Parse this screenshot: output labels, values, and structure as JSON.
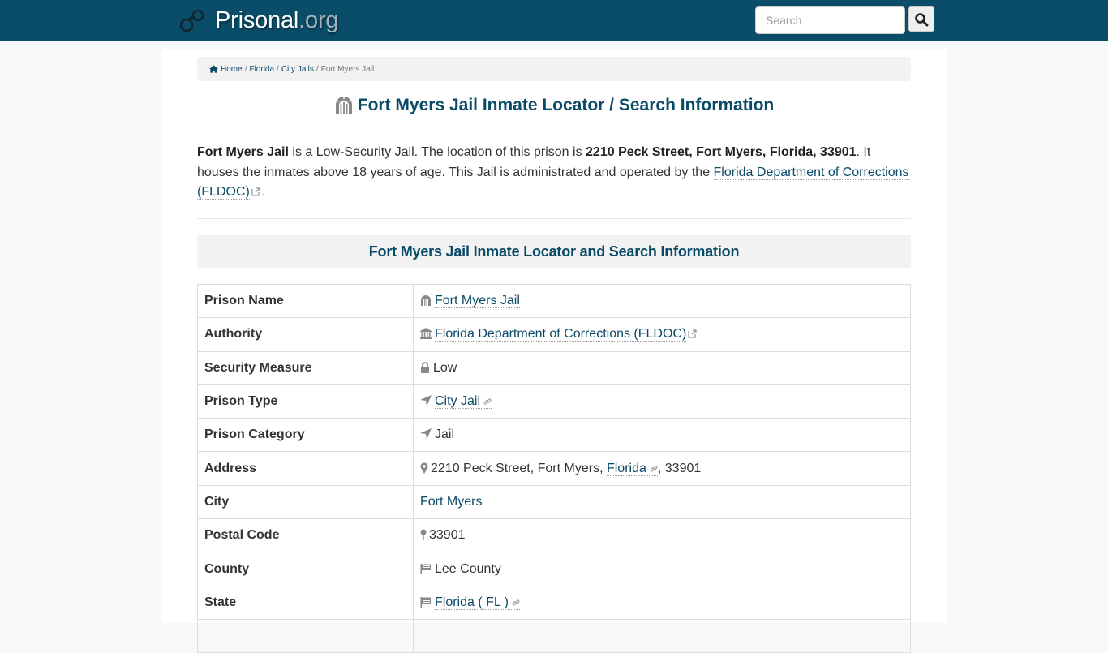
{
  "header": {
    "brand_name": "Prisonal",
    "brand_tld": ".org",
    "search_placeholder": "Search",
    "search_value": ""
  },
  "breadcrumb": {
    "items": [
      {
        "label": "Home",
        "link": true
      },
      {
        "label": "Florida",
        "link": true
      },
      {
        "label": "City Jails",
        "link": true
      },
      {
        "label": "Fort Myers Jail",
        "link": false
      }
    ],
    "separator": "/"
  },
  "page_title": "Fort Myers Jail Inmate Locator / Search Information",
  "intro": {
    "name": "Fort Myers Jail",
    "text1": " is a Low-Security Jail. The location of this prison is ",
    "address": "2210 Peck Street, Fort Myers, Florida, 33901",
    "text2": ". It houses the inmates above 18 years of age. This Jail is administrated and operated by the ",
    "authority_link": "Florida Department of Corrections (FLDOC)",
    "text3": "."
  },
  "section_heading": "Fort Myers Jail Inmate Locator and Search Information",
  "table": {
    "rows": [
      {
        "label": "Prison Name",
        "value": "Fort Myers Jail",
        "icon": "prison-icon"
      },
      {
        "label": "Authority",
        "value": "Florida Department of Corrections (FLDOC)",
        "icon": "institution-icon"
      },
      {
        "label": "Security Measure",
        "value": "Low",
        "icon": "lock-icon"
      },
      {
        "label": "Prison Type",
        "value": "City Jail",
        "icon": "location-arrow-icon"
      },
      {
        "label": "Prison Category",
        "value": "Jail",
        "icon": "location-arrow-icon"
      },
      {
        "label": "Address",
        "value_prefix": "2210 Peck Street, Fort Myers, ",
        "value_link": "Florida",
        "value_suffix": ", 33901",
        "icon": "map-marker-icon"
      },
      {
        "label": "City",
        "value": "Fort Myers"
      },
      {
        "label": "Postal Code",
        "value": "33901",
        "icon": "map-pin-icon"
      },
      {
        "label": "County",
        "value": "Lee County",
        "icon": "flag-icon"
      },
      {
        "label": "State",
        "value": "Florida ( FL )",
        "icon": "flag-icon"
      }
    ]
  },
  "colors": {
    "navbar": "#0a4d68",
    "link": "#0a4a66",
    "panel": "#f2f2f2"
  }
}
